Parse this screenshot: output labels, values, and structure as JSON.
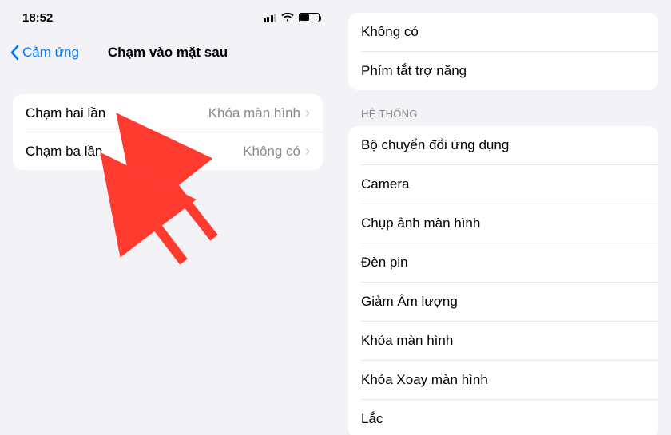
{
  "statusBar": {
    "time": "18:52"
  },
  "nav": {
    "backLabel": "Cảm ứng",
    "title": "Chạm vào mặt sau"
  },
  "leftRows": [
    {
      "label": "Chạm hai lần",
      "value": "Khóa màn hình"
    },
    {
      "label": "Chạm ba lần",
      "value": "Không có"
    }
  ],
  "rightTop": [
    {
      "label": "Không có"
    },
    {
      "label": "Phím tắt trợ năng"
    }
  ],
  "sectionHeader": "HỆ THỐNG",
  "rightSystem": [
    {
      "label": "Bộ chuyển đổi ứng dụng"
    },
    {
      "label": "Camera"
    },
    {
      "label": "Chụp ảnh màn hình"
    },
    {
      "label": "Đèn pin"
    },
    {
      "label": "Giảm Âm lượng"
    },
    {
      "label": "Khóa màn hình"
    },
    {
      "label": "Khóa Xoay màn hình"
    },
    {
      "label": "Lắc"
    }
  ],
  "colors": {
    "accent": "#007aff",
    "arrow": "#ff3b30"
  }
}
